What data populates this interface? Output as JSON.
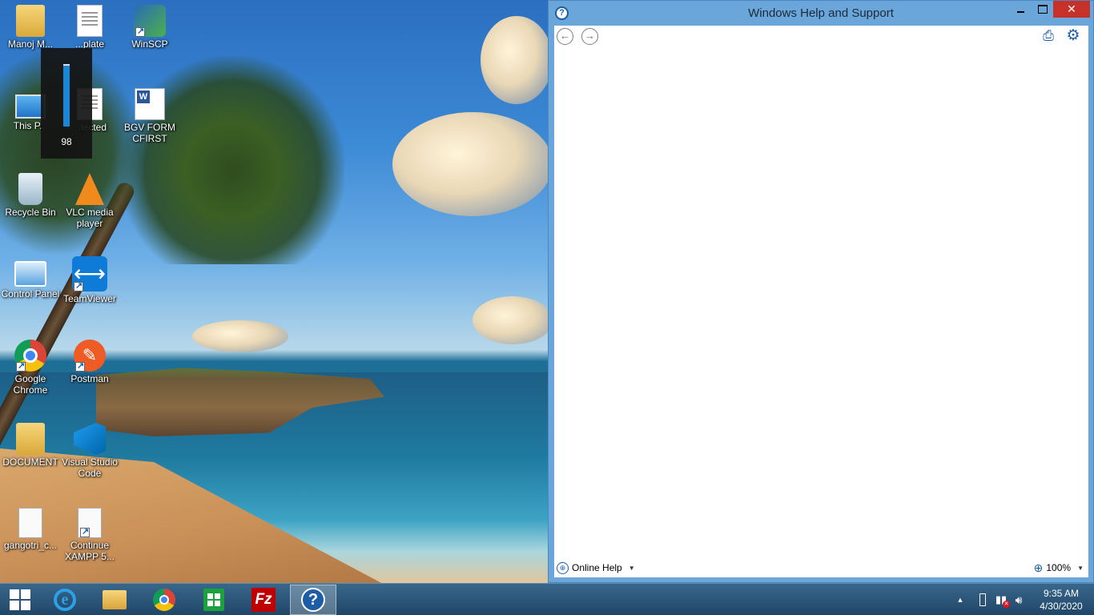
{
  "desktop": {
    "icons": [
      {
        "label": "Manoj M...",
        "icon": "user-folder-icon"
      },
      {
        "label": "...plate",
        "icon": "document-icon"
      },
      {
        "label": "WinSCP",
        "icon": "winscp-icon"
      },
      {
        "label": "This P...",
        "icon": "this-pc-icon"
      },
      {
        "label": "...lected",
        "icon": "document-icon"
      },
      {
        "label": "BGV FORM CFIRST",
        "icon": "word-document-icon"
      },
      {
        "label": "Recycle Bin",
        "icon": "recycle-bin-icon"
      },
      {
        "label": "VLC media player",
        "icon": "vlc-icon"
      },
      {
        "label": "Control Panel",
        "icon": "control-panel-icon"
      },
      {
        "label": "TeamViewer",
        "icon": "teamviewer-icon"
      },
      {
        "label": "Google Chrome",
        "icon": "chrome-icon"
      },
      {
        "label": "Postman",
        "icon": "postman-icon"
      },
      {
        "label": "DOCUMENT",
        "icon": "folder-icon"
      },
      {
        "label": "Visual Studio Code",
        "icon": "vscode-icon"
      },
      {
        "label": "gangotri_c...",
        "icon": "blank-file-icon"
      },
      {
        "label": "Continue XAMPP 5...",
        "icon": "blank-file-icon"
      }
    ]
  },
  "volume_osd": {
    "value": "98",
    "level_percent": 98
  },
  "help_window": {
    "title": "Windows Help and Support",
    "toolbar": {
      "back_icon": "back-arrow-icon",
      "forward_icon": "forward-arrow-icon",
      "print_icon": "print-icon",
      "settings_icon": "gear-icon"
    },
    "status": {
      "online_help_label": "Online Help",
      "zoom_label": "100%"
    }
  },
  "taskbar": {
    "apps": [
      "start-icon",
      "internet-explorer-icon",
      "file-explorer-icon",
      "chrome-icon",
      "store-icon",
      "filezilla-icon",
      "help-icon"
    ],
    "active_app": "help-icon",
    "clock_time": "9:35 AM",
    "clock_date": "4/30/2020"
  },
  "colors": {
    "title_bar": "#6aa6da",
    "close_button": "#c7312a",
    "accent": "#1c5da8"
  }
}
